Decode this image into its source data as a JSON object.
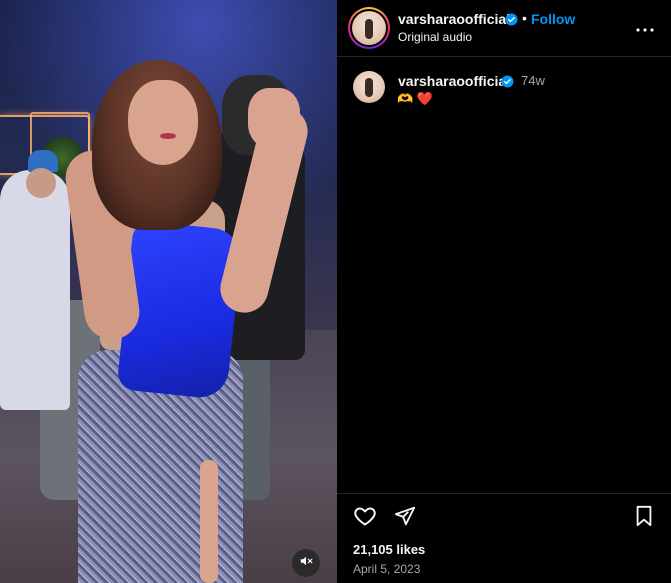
{
  "post": {
    "username": "varsharaoofficial",
    "verified": true,
    "separator": "•",
    "follow_label": "Follow",
    "audio_label": "Original audio",
    "more_icon": "more-options-icon"
  },
  "caption": {
    "username": "varsharaoofficial",
    "time_ago": "74w",
    "text": "🫶 ❤️"
  },
  "actions": {
    "like_icon": "heart-icon",
    "share_icon": "send-icon",
    "save_icon": "bookmark-icon"
  },
  "stats": {
    "likes": "21,105 likes",
    "date": "April 5, 2023"
  },
  "video": {
    "muted": true,
    "mute_icon": "speaker-muted-icon"
  },
  "colors": {
    "accent": "#0095f6",
    "background": "#000000",
    "text": "#f5f5f5",
    "secondary_text": "#a8a8a8",
    "verified_badge": "#0095f6"
  }
}
